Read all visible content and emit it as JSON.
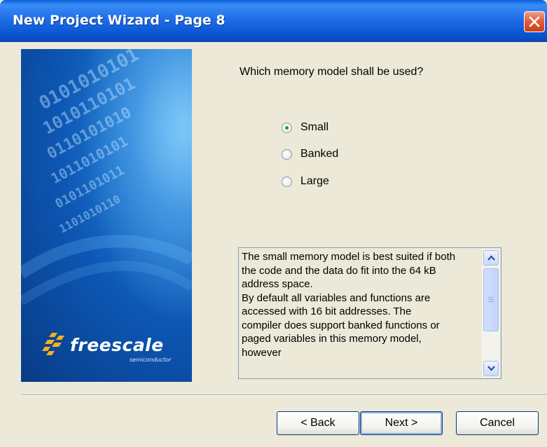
{
  "window": {
    "title": "New Project Wizard - Page  8"
  },
  "banner": {
    "logo_text": "freescale",
    "logo_subtext": "semiconductor",
    "background_binary": [
      "0101010101",
      "1010110101",
      "0110101010",
      "1011010101",
      "0101101011",
      "1101010110"
    ]
  },
  "main": {
    "question": "Which memory model shall be used?",
    "options": [
      {
        "label": "Small",
        "checked": true
      },
      {
        "label": "Banked",
        "checked": false
      },
      {
        "label": "Large",
        "checked": false
      }
    ],
    "description": "The small memory model is best suited if both\nthe code and the data do fit into the 64 kB\naddress space.\nBy default all variables and functions are\naccessed with 16 bit addresses. The\ncompiler does support banked functions or\npaged variables in this memory model,\nhowever"
  },
  "buttons": {
    "back": "< Back",
    "next": "Next >",
    "cancel": "Cancel"
  },
  "colors": {
    "titlebar": "#0a5fd8",
    "window_bg": "#ece9d8",
    "close": "#e0603c",
    "radio_dot": "#20a020"
  }
}
